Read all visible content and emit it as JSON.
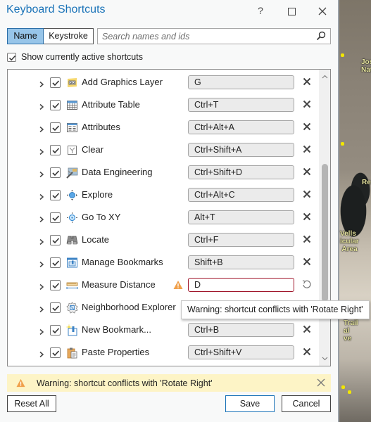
{
  "window": {
    "title": "Keyboard Shortcuts",
    "help_label": "?",
    "maximize_icon": "maximize-icon",
    "close_icon": "close-icon"
  },
  "search_mode": {
    "options": [
      "Name",
      "Keystroke"
    ],
    "selected": "Name"
  },
  "search": {
    "placeholder": "Search names and ids",
    "value": "",
    "icon": "search-icon"
  },
  "show_active": {
    "label": "Show currently active shortcuts",
    "checked": true
  },
  "shortcuts": [
    {
      "name": "Add Graphics Layer",
      "icon": "graphics-layer-icon",
      "keystroke": "G",
      "checked": true
    },
    {
      "name": "Attribute Table",
      "icon": "table-icon",
      "keystroke": "Ctrl+T",
      "checked": true
    },
    {
      "name": "Attributes",
      "icon": "attributes-icon",
      "keystroke": "Ctrl+Alt+A",
      "checked": true
    },
    {
      "name": "Clear",
      "icon": "clear-selection-icon",
      "keystroke": "Ctrl+Shift+A",
      "checked": true
    },
    {
      "name": "Data Engineering",
      "icon": "data-engineering-icon",
      "keystroke": "Ctrl+Shift+D",
      "checked": true
    },
    {
      "name": "Explore",
      "icon": "explore-icon",
      "keystroke": "Ctrl+Alt+C",
      "checked": true
    },
    {
      "name": "Go To XY",
      "icon": "go-to-xy-icon",
      "keystroke": "Alt+T",
      "checked": true
    },
    {
      "name": "Locate",
      "icon": "binoculars-icon",
      "keystroke": "Ctrl+F",
      "checked": true
    },
    {
      "name": "Manage Bookmarks",
      "icon": "manage-bookmarks-icon",
      "keystroke": "Shift+B",
      "checked": true
    },
    {
      "name": "Measure Distance",
      "icon": "ruler-icon",
      "keystroke": "D",
      "checked": true,
      "conflict": true
    },
    {
      "name": "Neighborhood Explorer",
      "icon": "neighborhood-explorer-icon",
      "keystroke": "",
      "checked": true
    },
    {
      "name": "New Bookmark...",
      "icon": "new-bookmark-icon",
      "keystroke": "Ctrl+B",
      "checked": true
    },
    {
      "name": "Paste Properties",
      "icon": "paste-properties-icon",
      "keystroke": "Ctrl+Shift+V",
      "checked": true
    }
  ],
  "tooltip": {
    "text": "Warning: shortcut conflicts with 'Rotate Right'"
  },
  "scroll": {
    "position_fraction": 0.45
  },
  "banner": {
    "message": "Warning: shortcut conflicts with 'Rotate Right'",
    "color": "#fdf4c6"
  },
  "buttons": {
    "reset_all": "Reset All",
    "save": "Save",
    "cancel": "Cancel"
  },
  "map": {
    "labels": [
      "Jos\nNat",
      "Re",
      "Vells\nicular\n Area",
      "Trail\nal\nve"
    ]
  },
  "colors": {
    "accent": "#1a73b8",
    "selected_tab": "#97c5e9",
    "conflict_border": "#a0152a",
    "warning": "#f0a04b"
  }
}
